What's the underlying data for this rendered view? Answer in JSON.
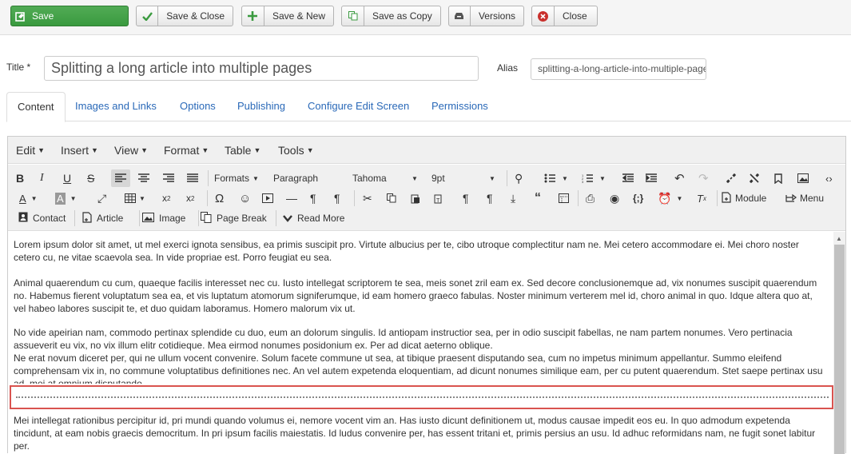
{
  "toolbar": {
    "save": "Save",
    "save_close": "Save & Close",
    "save_new": "Save & New",
    "save_copy": "Save as Copy",
    "versions": "Versions",
    "close": "Close"
  },
  "form": {
    "title_label": "Title *",
    "title_value": "Splitting a long article into multiple pages",
    "alias_label": "Alias",
    "alias_value": "splitting-a-long-article-into-multiple-pages"
  },
  "tabs": [
    "Content",
    "Images and Links",
    "Options",
    "Publishing",
    "Configure Edit Screen",
    "Permissions"
  ],
  "editor": {
    "menu": [
      "Edit",
      "Insert",
      "View",
      "Format",
      "Table",
      "Tools"
    ],
    "formats_label": "Formats",
    "block_format": "Paragraph",
    "font_family": "Tahoma",
    "font_size": "9pt",
    "buttons": {
      "module": "Module",
      "menu": "Menu",
      "contact": "Contact",
      "article": "Article",
      "image": "Image",
      "page_break": "Page Break",
      "read_more": "Read More"
    },
    "paragraphs": [
      "Lorem ipsum dolor sit amet, ut mel exerci ignota sensibus, ea primis suscipit pro. Virtute albucius per te, cibo utroque complectitur nam ne. Mei cetero accommodare ei. Mei choro noster cetero cu, ne vitae scaevola sea. In vide propriae est. Porro feugiat eu sea.",
      "Animal quaerendum cu cum, quaeque facilis interesset nec cu. Iusto intellegat scriptorem te sea, meis sonet zril eam ex. Sed decore conclusionemque ad, vix nonumes suscipit quaerendum no. Habemus fierent voluptatum sea ea, et vis luptatum atomorum signiferumque, id eam homero graeco fabulas. Noster minimum verterem mel id, choro animal in quo. Idque altera quo at, vel habeo labores suscipit te, et duo quidam laboramus. Homero malorum vix ut.",
      "No vide apeirian nam, commodo pertinax splendide cu duo, eum an dolorum singulis. Id antiopam instructior sea, per in odio suscipit fabellas, ne nam partem nonumes. Vero pertinacia assueverit eu vix, no vix illum elitr cotidieque. Mea eirmod nonumes posidonium ex. Per ad dicat aeterno oblique.",
      "Ne erat novum diceret per, qui ne ullum vocent convenire. Solum facete commune ut sea, at tibique praesent disputando sea, cum no impetus minimum appellantur. Summo eleifend comprehensam vix in, no commune voluptatibus definitiones nec. An vel autem expetenda eloquentiam, ad dicunt nonumes similique eam, per cu putent quaerendum. Stet saepe pertinax usu ad, mei at omnium disputando.",
      "Mei intellegat rationibus percipitur id, pri mundi quando volumus ei, nemore vocent vim an. Has iusto dicunt definitionem ut, modus causae impedit eos eu. In quo admodum expetenda tincidunt, at eam nobis graecis democritum. In pri ipsum facilis maiestatis. Id ludus convenire per, has essent tritani et, primis persius an usu. Id adhuc reformidans nam, ne fugit sonet labitur per."
    ]
  }
}
